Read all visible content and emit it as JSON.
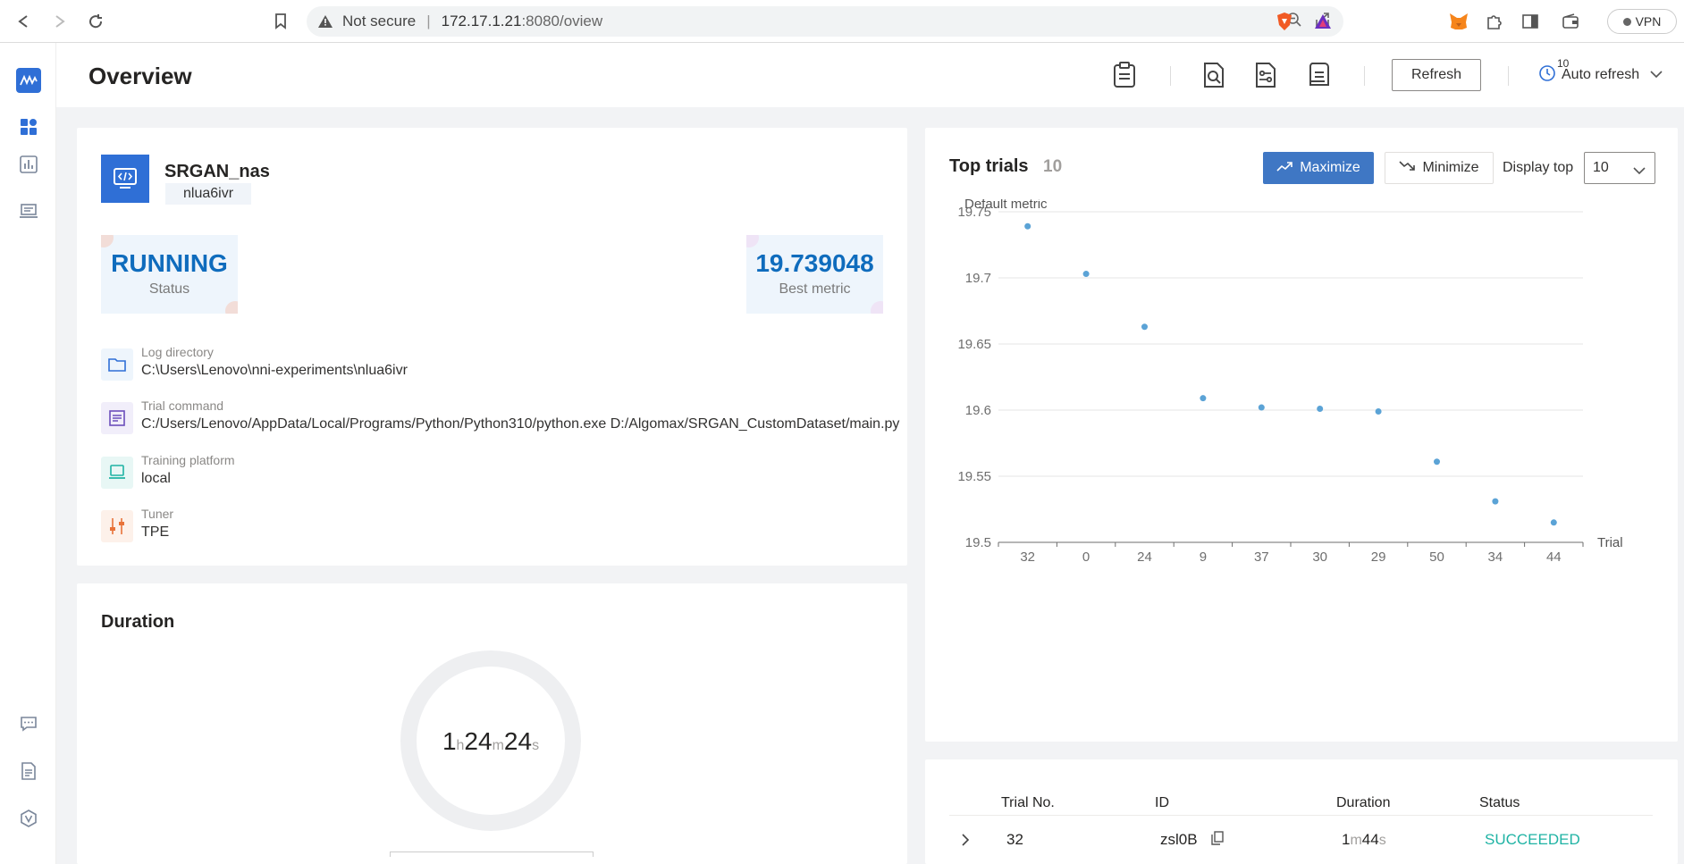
{
  "browser": {
    "warning": "Not secure",
    "url_host": "172.17.1.21",
    "url_path": ":8080/oview",
    "vpn_label": "VPN"
  },
  "header": {
    "title": "Overview",
    "refresh_label": "Refresh",
    "auto_refresh_label": "Auto refresh",
    "auto_refresh_badge": "10"
  },
  "experiment": {
    "name": "SRGAN_nas",
    "id": "nlua6ivr",
    "status_value": "RUNNING",
    "status_label": "Status",
    "best_metric_value": "19.739048",
    "best_metric_label": "Best metric",
    "info": [
      {
        "label": "Log directory",
        "value": "C:\\Users\\Lenovo\\nni-experiments\\nlua6ivr",
        "icon": "folder-icon",
        "color": "#2f6fd6"
      },
      {
        "label": "Trial command",
        "value": "C:/Users/Lenovo/AppData/Local/Programs/Python/Python310/python.exe D:/Algomax/SRGAN_CustomDataset/main.py",
        "icon": "document-icon",
        "color": "#6b4fbb"
      },
      {
        "label": "Training platform",
        "value": "local",
        "icon": "laptop-icon",
        "color": "#1fb3a4"
      },
      {
        "label": "Tuner",
        "value": "TPE",
        "icon": "tuner-icon",
        "color": "#e8733a"
      }
    ]
  },
  "duration": {
    "title": "Duration",
    "hours": "1",
    "h_unit": "h",
    "minutes": "24",
    "m_unit": "m",
    "seconds": "24",
    "s_unit": "s"
  },
  "top_trials": {
    "title": "Top trials",
    "count": "10",
    "maximize_label": "Maximize",
    "minimize_label": "Minimize",
    "display_top_label": "Display top",
    "display_top_value": "10"
  },
  "chart_data": {
    "type": "scatter",
    "title": "",
    "ylabel": "Default metric",
    "xlabel": "Trial",
    "categories": [
      "32",
      "0",
      "24",
      "9",
      "37",
      "30",
      "29",
      "50",
      "34",
      "44"
    ],
    "values": [
      19.739,
      19.703,
      19.663,
      19.609,
      19.602,
      19.601,
      19.599,
      19.561,
      19.531,
      19.515
    ],
    "ylim": [
      19.5,
      19.75
    ],
    "yticks": [
      "19.75",
      "19.7",
      "19.65",
      "19.6",
      "19.55",
      "19.5"
    ],
    "point_color": "#5ba3d6",
    "grid": true
  },
  "trials_table": {
    "headers": [
      "Trial No.",
      "ID",
      "Duration",
      "Status"
    ],
    "rows": [
      {
        "trial_no": "32",
        "id": "zsl0B",
        "dur_min": "1",
        "dur_m_unit": "m",
        "dur_sec": "44",
        "dur_s_unit": "s",
        "status": "SUCCEEDED"
      }
    ]
  }
}
